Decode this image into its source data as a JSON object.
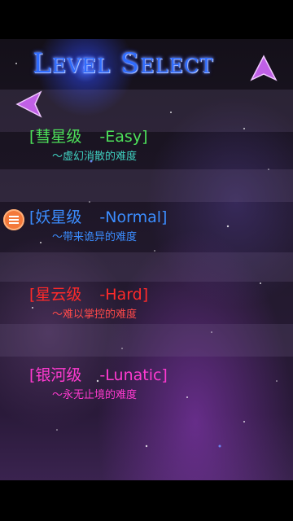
{
  "title": "Level Select",
  "nav": {
    "up_icon": "triangle-up-icon",
    "back_icon": "triangle-left-icon",
    "arrow_color": "#c060e6"
  },
  "levels": [
    {
      "name": "[彗星级",
      "difficulty": "-Easy]",
      "description": "～虚幻消散的难度",
      "color": "#4de05a",
      "desc_color": "#3fd0c0"
    },
    {
      "name": "[妖星级",
      "difficulty": "-Normal]",
      "description": "～带来诡异的难度",
      "color": "#3b8dff",
      "desc_color": "#3b8dff"
    },
    {
      "name": "[星云级",
      "difficulty": "-Hard]",
      "description": "～难以掌控的难度",
      "color": "#ff2a2a",
      "desc_color": "#ff4a4a"
    },
    {
      "name": "[银河级",
      "difficulty": "-Lunatic]",
      "description": "～永无止境的难度",
      "color": "#ff3ad0",
      "desc_color": "#ff3ad0"
    }
  ],
  "floating_menu": {
    "icon": "hamburger-menu-icon",
    "color": "#f4793a"
  }
}
